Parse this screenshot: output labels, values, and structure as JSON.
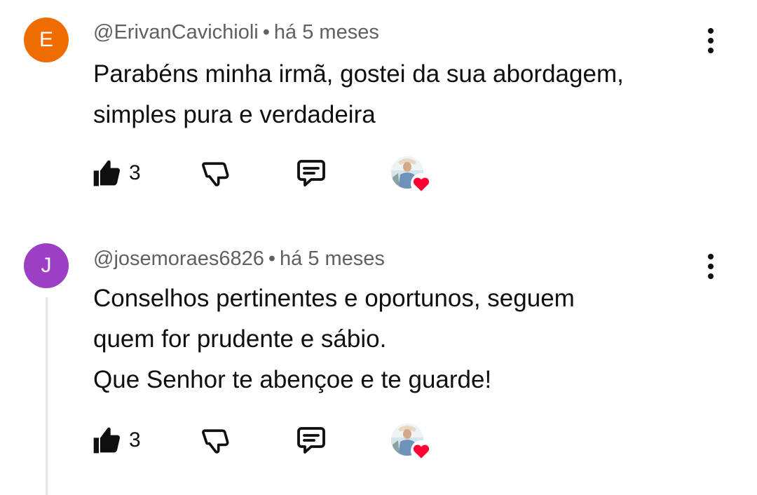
{
  "comments": [
    {
      "avatar_letter": "E",
      "avatar_color": "#ef6c00",
      "author": "@ErivanCavichioli",
      "separator": "•",
      "time": "há 5 meses",
      "lines": [
        "Parabéns minha irmã, gostei da sua abordagem,",
        "simples pura e verdadeira"
      ],
      "like_count": "3"
    },
    {
      "avatar_letter": "J",
      "avatar_color": "#9c3fc5",
      "author": "@josemoraes6826",
      "separator": "•",
      "time": "há 5 meses",
      "lines": [
        "Conselhos pertinentes e oportunos, seguem",
        "quem for prudente e sábio.",
        "Que Senhor te abençoe e te guarde!"
      ],
      "like_count": "3"
    }
  ],
  "icons": {
    "like": "thumbs-up-icon",
    "dislike": "thumbs-down-icon",
    "reply": "reply-icon",
    "more": "more-vertical-icon",
    "creator_heart": "heart-icon"
  },
  "colors": {
    "heart": "#ff0033",
    "text": "#0f0f0f",
    "meta": "#606060"
  }
}
